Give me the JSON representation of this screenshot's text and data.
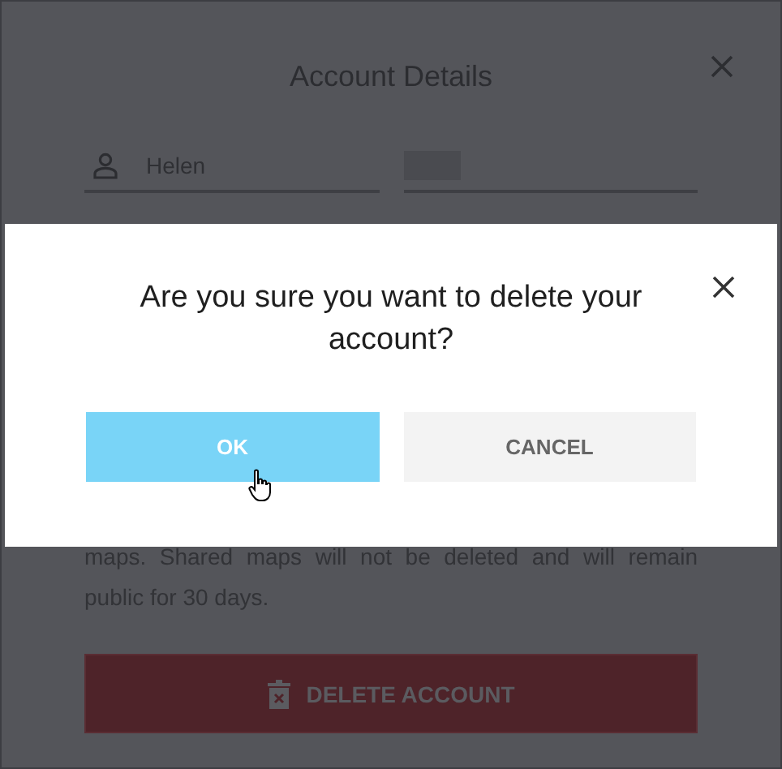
{
  "background_dialog": {
    "title": "Account Details",
    "first_name": {
      "value": "Helen"
    },
    "notice": "maps. Shared maps will not be deleted and will remain public for 30 days.",
    "delete_button": "DELETE ACCOUNT"
  },
  "confirm_dialog": {
    "message": "Are you sure you want to delete your account?",
    "buttons": [
      {
        "label": "OK",
        "kind": "primary",
        "hovered": true
      },
      {
        "label": "CANCEL",
        "kind": "secondary",
        "hovered": false
      }
    ]
  }
}
